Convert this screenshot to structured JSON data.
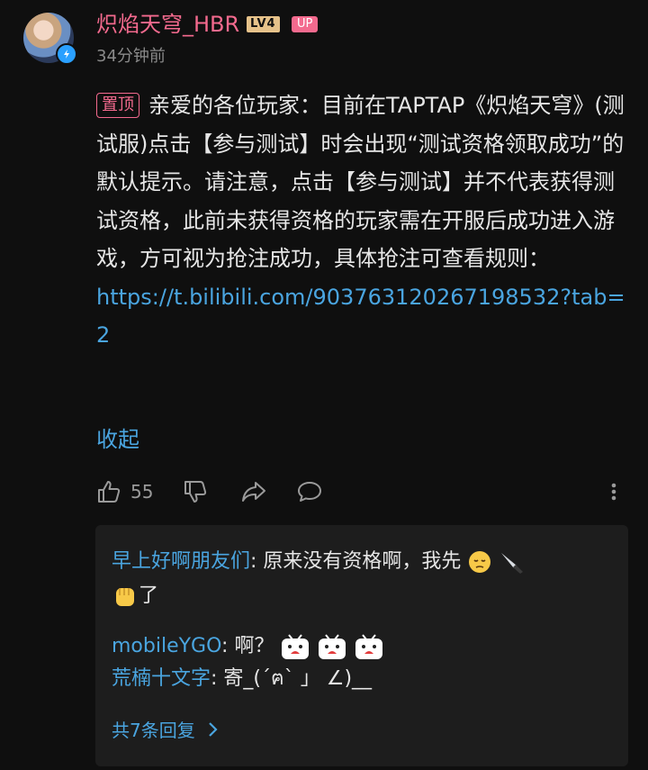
{
  "post": {
    "username": "炽焰天穹_HBR",
    "level": "LV4",
    "up_badge": "UP",
    "time": "34分钟前",
    "pin_label": "置顶",
    "text": "亲爱的各位玩家：目前在TAPTAP《炽焰天穹》(测试服)点击【参与测试】时会出现“测试资格领取成功”的默认提示。请注意，点击【参与测试】并不代表获得测试资格，此前未获得资格的玩家需在开服后成功进入游戏，方可视为抢注成功，具体抢注可查看规则：",
    "link": "https://t.bilibili.com/903763120267198532?tab=2",
    "collapse": "收起"
  },
  "actions": {
    "like_count": "55",
    "icons": [
      "thumb-up-icon",
      "thumb-down-icon",
      "share-icon",
      "comment-icon",
      "more-vertical-icon"
    ]
  },
  "replies": [
    {
      "name": "早上好啊朋友们",
      "sep": ":",
      "text": " 原来没有资格啊，我先",
      "emoji": [
        "pensive-emoji",
        "knife-emoji",
        "fist-emoji"
      ],
      "tail": "了"
    },
    {
      "name": "mobileYGO",
      "sep": ":",
      "text": " 啊？",
      "emoji": [
        "tv-sticker",
        "tv-sticker",
        "tv-sticker"
      ]
    },
    {
      "name": "荒楠十文字",
      "sep": ":",
      "text": " 寄_(´ฅ` 」 ∠)__"
    }
  ],
  "more_replies": "共7条回复",
  "colors": {
    "accent_pink": "#f36a8e",
    "link_blue": "#4aa5e0",
    "background": "#0f0f0f",
    "reply_bg": "#1d1d1d"
  }
}
